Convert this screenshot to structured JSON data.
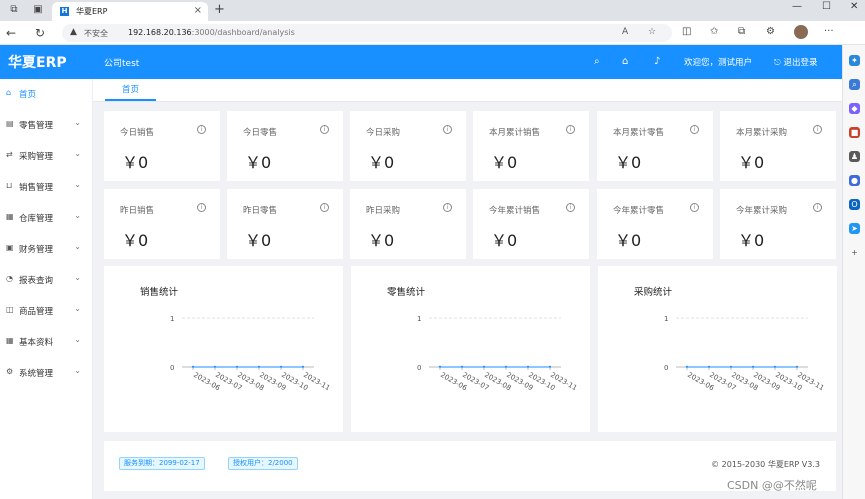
{
  "browser": {
    "tab_title": "华夏ERP",
    "insecure_label": "不安全",
    "url_host": "192.168.20.136",
    "url_path": ":3000/dashboard/analysis"
  },
  "header": {
    "logo": "华夏ERP",
    "company": "公司test",
    "welcome": "欢迎您，测试用户",
    "logout": "退出登录"
  },
  "sidebar": {
    "items": [
      {
        "label": "首页",
        "icon": "home-icon",
        "active": true
      },
      {
        "label": "零售管理",
        "icon": "retail-icon"
      },
      {
        "label": "采购管理",
        "icon": "purchase-icon"
      },
      {
        "label": "销售管理",
        "icon": "cart-icon"
      },
      {
        "label": "仓库管理",
        "icon": "warehouse-icon"
      },
      {
        "label": "财务管理",
        "icon": "finance-icon"
      },
      {
        "label": "报表查询",
        "icon": "report-icon"
      },
      {
        "label": "商品管理",
        "icon": "product-icon"
      },
      {
        "label": "基本资料",
        "icon": "grid-icon"
      },
      {
        "label": "系统管理",
        "icon": "settings-icon"
      }
    ]
  },
  "page_tab": "首页",
  "stats_row1": [
    {
      "label": "今日销售",
      "value": "￥0"
    },
    {
      "label": "今日零售",
      "value": "￥0"
    },
    {
      "label": "今日采购",
      "value": "￥0"
    },
    {
      "label": "本月累计销售",
      "value": "￥0"
    },
    {
      "label": "本月累计零售",
      "value": "￥0"
    },
    {
      "label": "本月累计采购",
      "value": "￥0"
    }
  ],
  "stats_row2": [
    {
      "label": "昨日销售",
      "value": "￥0"
    },
    {
      "label": "昨日零售",
      "value": "￥0"
    },
    {
      "label": "昨日采购",
      "value": "￥0"
    },
    {
      "label": "今年累计销售",
      "value": "￥0"
    },
    {
      "label": "今年累计零售",
      "value": "￥0"
    },
    {
      "label": "今年累计采购",
      "value": "￥0"
    }
  ],
  "chart_data": [
    {
      "type": "line",
      "title": "销售统计",
      "x": [
        "2023-06",
        "2023-07",
        "2023-08",
        "2023-09",
        "2023-10",
        "2023-11"
      ],
      "y_ticks": [
        "0",
        "1"
      ],
      "ylim": [
        0,
        1
      ],
      "series": [
        {
          "values": [
            0,
            0,
            0,
            0,
            0,
            0
          ]
        }
      ]
    },
    {
      "type": "line",
      "title": "零售统计",
      "x": [
        "2023-06",
        "2023-07",
        "2023-08",
        "2023-09",
        "2023-10",
        "2023-11"
      ],
      "y_ticks": [
        "0",
        "1"
      ],
      "ylim": [
        0,
        1
      ],
      "series": [
        {
          "values": [
            0,
            0,
            0,
            0,
            0,
            0
          ]
        }
      ]
    },
    {
      "type": "line",
      "title": "采购统计",
      "x": [
        "2023-06",
        "2023-07",
        "2023-08",
        "2023-09",
        "2023-10",
        "2023-11"
      ],
      "y_ticks": [
        "0",
        "1"
      ],
      "ylim": [
        0,
        1
      ],
      "series": [
        {
          "values": [
            0,
            0,
            0,
            0,
            0,
            0
          ]
        }
      ]
    }
  ],
  "footer": {
    "service_badge": "服务到期：2099-02-17",
    "license_badge": "授权用户：2/2000",
    "copyright": "© 2015-2030 华夏ERP V3.3"
  },
  "watermark": "CSDN @@不然呢",
  "colors": {
    "primary": "#1890ff",
    "bg": "#f0f2f5"
  }
}
